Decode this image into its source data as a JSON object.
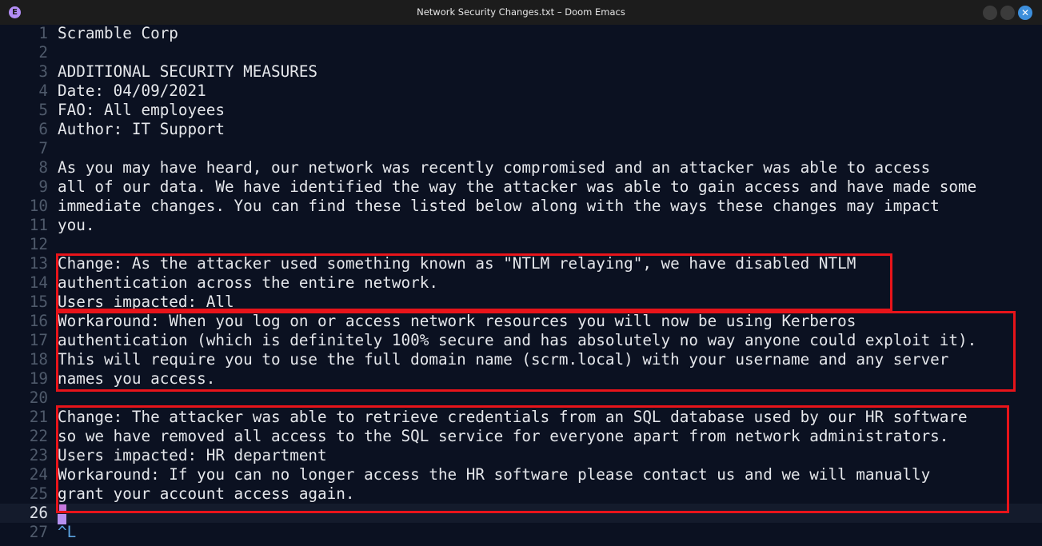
{
  "window": {
    "title": "Network Security Changes.txt – Doom Emacs",
    "app_icon_glyph": "E",
    "close_glyph": "✕",
    "accent_color": "#3d8fdc",
    "highlight_box_color": "#e8141a"
  },
  "editor": {
    "current_line": 26,
    "lines": [
      {
        "num": "1",
        "text": "Scramble Corp"
      },
      {
        "num": "2",
        "text": ""
      },
      {
        "num": "3",
        "text": "ADDITIONAL SECURITY MEASURES"
      },
      {
        "num": "4",
        "text": "Date: 04/09/2021"
      },
      {
        "num": "5",
        "text": "FAO: All employees"
      },
      {
        "num": "6",
        "text": "Author: IT Support"
      },
      {
        "num": "7",
        "text": ""
      },
      {
        "num": "8",
        "text": "As you may have heard, our network was recently compromised and an attacker was able to access"
      },
      {
        "num": "9",
        "text": "all of our data. We have identified the way the attacker was able to gain access and have made some"
      },
      {
        "num": "10",
        "text": "immediate changes. You can find these listed below along with the ways these changes may impact"
      },
      {
        "num": "11",
        "text": "you."
      },
      {
        "num": "12",
        "text": ""
      },
      {
        "num": "13",
        "text": "Change: As the attacker used something known as \"NTLM relaying\", we have disabled NTLM"
      },
      {
        "num": "14",
        "text": "authentication across the entire network."
      },
      {
        "num": "15",
        "text": "Users impacted: All"
      },
      {
        "num": "16",
        "text": "Workaround: When you log on or access network resources you will now be using Kerberos"
      },
      {
        "num": "17",
        "text": "authentication (which is definitely 100% secure and has absolutely no way anyone could exploit it)."
      },
      {
        "num": "18",
        "text": "This will require you to use the full domain name (scrm.local) with your username and any server"
      },
      {
        "num": "19",
        "text": "names you access."
      },
      {
        "num": "20",
        "text": ""
      },
      {
        "num": "21",
        "text": "Change: The attacker was able to retrieve credentials from an SQL database used by our HR software"
      },
      {
        "num": "22",
        "text": "so we have removed all access to the SQL service for everyone apart from network administrators."
      },
      {
        "num": "23",
        "text": "Users impacted: HR department"
      },
      {
        "num": "24",
        "text": "Workaround: If you can no longer access the HR software please contact us and we will manually"
      },
      {
        "num": "25",
        "text": "grant your account access again."
      },
      {
        "num": "26",
        "text": ""
      },
      {
        "num": "27",
        "text": "^L"
      }
    ]
  }
}
